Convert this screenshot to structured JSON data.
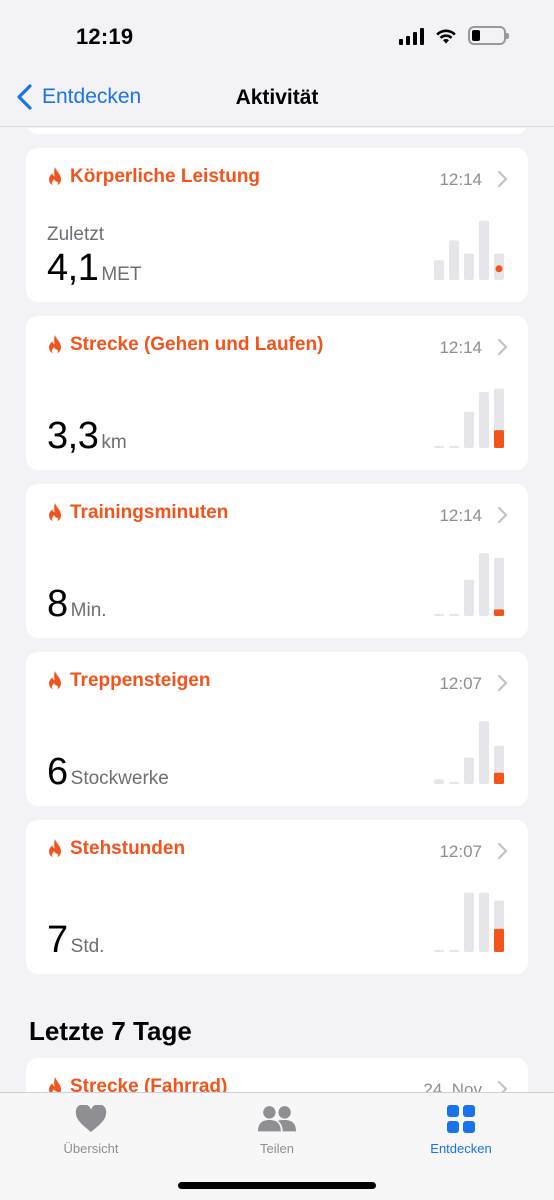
{
  "status_bar": {
    "time": "12:19"
  },
  "nav": {
    "back_label": "Entdecken",
    "title": "Aktivität"
  },
  "accent_color": "#f2541b",
  "link_color": "#1a73e8",
  "cards": [
    {
      "title": "Körperliche Leistung",
      "time": "12:14",
      "subtitle": "Zuletzt",
      "value": "4,1",
      "unit": "MET",
      "chart_style": "dot",
      "bars": [
        0.3,
        0.6,
        0.4,
        0.9,
        0.4
      ],
      "highlight": 0.0
    },
    {
      "title": "Strecke (Gehen und Laufen)",
      "time": "12:14",
      "subtitle": "",
      "value": "3,3",
      "unit": "km",
      "chart_style": "bar",
      "bars": [
        0.03,
        0.03,
        0.55,
        0.85,
        0.9
      ],
      "highlight": 0.27
    },
    {
      "title": "Trainingsminuten",
      "time": "12:14",
      "subtitle": "",
      "value": "8",
      "unit": "Min.",
      "chart_style": "bar",
      "bars": [
        0.0,
        0.0,
        0.55,
        0.95,
        0.88
      ],
      "highlight": 0.1
    },
    {
      "title": "Treppensteigen",
      "time": "12:07",
      "subtitle": "",
      "value": "6",
      "unit": "Stockwerke",
      "chart_style": "bar",
      "bars": [
        0.07,
        0.03,
        0.4,
        0.95,
        0.58
      ],
      "highlight": 0.17
    },
    {
      "title": "Stehstunden",
      "time": "12:07",
      "subtitle": "",
      "value": "7",
      "unit": "Std.",
      "chart_style": "bar",
      "bars": [
        0.0,
        0.03,
        0.9,
        0.9,
        0.78
      ],
      "highlight": 0.35
    }
  ],
  "section": {
    "title": "Letzte 7 Tage"
  },
  "partial_card": {
    "title": "Strecke (Fahrrad)",
    "date": "24. Nov"
  },
  "tabs": [
    {
      "label": "Übersicht",
      "icon": "heart-icon",
      "active": false
    },
    {
      "label": "Teilen",
      "icon": "people-icon",
      "active": false
    },
    {
      "label": "Entdecken",
      "icon": "grid-icon",
      "active": true
    }
  ]
}
